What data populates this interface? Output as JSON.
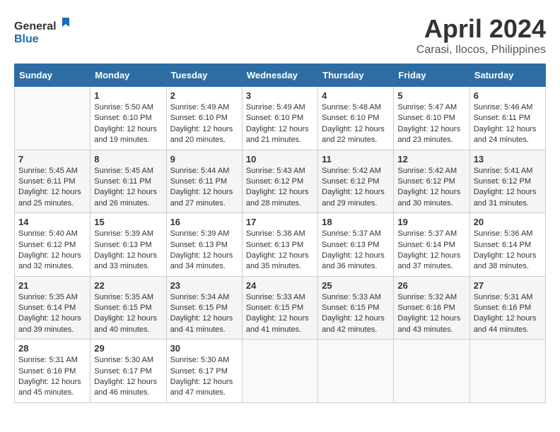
{
  "logo": {
    "text_general": "General",
    "text_blue": "Blue"
  },
  "header": {
    "month_year": "April 2024",
    "location": "Carasi, Ilocos, Philippines"
  },
  "weekdays": [
    "Sunday",
    "Monday",
    "Tuesday",
    "Wednesday",
    "Thursday",
    "Friday",
    "Saturday"
  ],
  "weeks": [
    [
      {
        "day": "",
        "sunrise": "",
        "sunset": "",
        "daylight": ""
      },
      {
        "day": "1",
        "sunrise": "Sunrise: 5:50 AM",
        "sunset": "Sunset: 6:10 PM",
        "daylight": "Daylight: 12 hours and 19 minutes."
      },
      {
        "day": "2",
        "sunrise": "Sunrise: 5:49 AM",
        "sunset": "Sunset: 6:10 PM",
        "daylight": "Daylight: 12 hours and 20 minutes."
      },
      {
        "day": "3",
        "sunrise": "Sunrise: 5:49 AM",
        "sunset": "Sunset: 6:10 PM",
        "daylight": "Daylight: 12 hours and 21 minutes."
      },
      {
        "day": "4",
        "sunrise": "Sunrise: 5:48 AM",
        "sunset": "Sunset: 6:10 PM",
        "daylight": "Daylight: 12 hours and 22 minutes."
      },
      {
        "day": "5",
        "sunrise": "Sunrise: 5:47 AM",
        "sunset": "Sunset: 6:10 PM",
        "daylight": "Daylight: 12 hours and 23 minutes."
      },
      {
        "day": "6",
        "sunrise": "Sunrise: 5:46 AM",
        "sunset": "Sunset: 6:11 PM",
        "daylight": "Daylight: 12 hours and 24 minutes."
      }
    ],
    [
      {
        "day": "7",
        "sunrise": "Sunrise: 5:45 AM",
        "sunset": "Sunset: 6:11 PM",
        "daylight": "Daylight: 12 hours and 25 minutes."
      },
      {
        "day": "8",
        "sunrise": "Sunrise: 5:45 AM",
        "sunset": "Sunset: 6:11 PM",
        "daylight": "Daylight: 12 hours and 26 minutes."
      },
      {
        "day": "9",
        "sunrise": "Sunrise: 5:44 AM",
        "sunset": "Sunset: 6:11 PM",
        "daylight": "Daylight: 12 hours and 27 minutes."
      },
      {
        "day": "10",
        "sunrise": "Sunrise: 5:43 AM",
        "sunset": "Sunset: 6:12 PM",
        "daylight": "Daylight: 12 hours and 28 minutes."
      },
      {
        "day": "11",
        "sunrise": "Sunrise: 5:42 AM",
        "sunset": "Sunset: 6:12 PM",
        "daylight": "Daylight: 12 hours and 29 minutes."
      },
      {
        "day": "12",
        "sunrise": "Sunrise: 5:42 AM",
        "sunset": "Sunset: 6:12 PM",
        "daylight": "Daylight: 12 hours and 30 minutes."
      },
      {
        "day": "13",
        "sunrise": "Sunrise: 5:41 AM",
        "sunset": "Sunset: 6:12 PM",
        "daylight": "Daylight: 12 hours and 31 minutes."
      }
    ],
    [
      {
        "day": "14",
        "sunrise": "Sunrise: 5:40 AM",
        "sunset": "Sunset: 6:12 PM",
        "daylight": "Daylight: 12 hours and 32 minutes."
      },
      {
        "day": "15",
        "sunrise": "Sunrise: 5:39 AM",
        "sunset": "Sunset: 6:13 PM",
        "daylight": "Daylight: 12 hours and 33 minutes."
      },
      {
        "day": "16",
        "sunrise": "Sunrise: 5:39 AM",
        "sunset": "Sunset: 6:13 PM",
        "daylight": "Daylight: 12 hours and 34 minutes."
      },
      {
        "day": "17",
        "sunrise": "Sunrise: 5:38 AM",
        "sunset": "Sunset: 6:13 PM",
        "daylight": "Daylight: 12 hours and 35 minutes."
      },
      {
        "day": "18",
        "sunrise": "Sunrise: 5:37 AM",
        "sunset": "Sunset: 6:13 PM",
        "daylight": "Daylight: 12 hours and 36 minutes."
      },
      {
        "day": "19",
        "sunrise": "Sunrise: 5:37 AM",
        "sunset": "Sunset: 6:14 PM",
        "daylight": "Daylight: 12 hours and 37 minutes."
      },
      {
        "day": "20",
        "sunrise": "Sunrise: 5:36 AM",
        "sunset": "Sunset: 6:14 PM",
        "daylight": "Daylight: 12 hours and 38 minutes."
      }
    ],
    [
      {
        "day": "21",
        "sunrise": "Sunrise: 5:35 AM",
        "sunset": "Sunset: 6:14 PM",
        "daylight": "Daylight: 12 hours and 39 minutes."
      },
      {
        "day": "22",
        "sunrise": "Sunrise: 5:35 AM",
        "sunset": "Sunset: 6:15 PM",
        "daylight": "Daylight: 12 hours and 40 minutes."
      },
      {
        "day": "23",
        "sunrise": "Sunrise: 5:34 AM",
        "sunset": "Sunset: 6:15 PM",
        "daylight": "Daylight: 12 hours and 41 minutes."
      },
      {
        "day": "24",
        "sunrise": "Sunrise: 5:33 AM",
        "sunset": "Sunset: 6:15 PM",
        "daylight": "Daylight: 12 hours and 41 minutes."
      },
      {
        "day": "25",
        "sunrise": "Sunrise: 5:33 AM",
        "sunset": "Sunset: 6:15 PM",
        "daylight": "Daylight: 12 hours and 42 minutes."
      },
      {
        "day": "26",
        "sunrise": "Sunrise: 5:32 AM",
        "sunset": "Sunset: 6:16 PM",
        "daylight": "Daylight: 12 hours and 43 minutes."
      },
      {
        "day": "27",
        "sunrise": "Sunrise: 5:31 AM",
        "sunset": "Sunset: 6:16 PM",
        "daylight": "Daylight: 12 hours and 44 minutes."
      }
    ],
    [
      {
        "day": "28",
        "sunrise": "Sunrise: 5:31 AM",
        "sunset": "Sunset: 6:16 PM",
        "daylight": "Daylight: 12 hours and 45 minutes."
      },
      {
        "day": "29",
        "sunrise": "Sunrise: 5:30 AM",
        "sunset": "Sunset: 6:17 PM",
        "daylight": "Daylight: 12 hours and 46 minutes."
      },
      {
        "day": "30",
        "sunrise": "Sunrise: 5:30 AM",
        "sunset": "Sunset: 6:17 PM",
        "daylight": "Daylight: 12 hours and 47 minutes."
      },
      {
        "day": "",
        "sunrise": "",
        "sunset": "",
        "daylight": ""
      },
      {
        "day": "",
        "sunrise": "",
        "sunset": "",
        "daylight": ""
      },
      {
        "day": "",
        "sunrise": "",
        "sunset": "",
        "daylight": ""
      },
      {
        "day": "",
        "sunrise": "",
        "sunset": "",
        "daylight": ""
      }
    ]
  ]
}
